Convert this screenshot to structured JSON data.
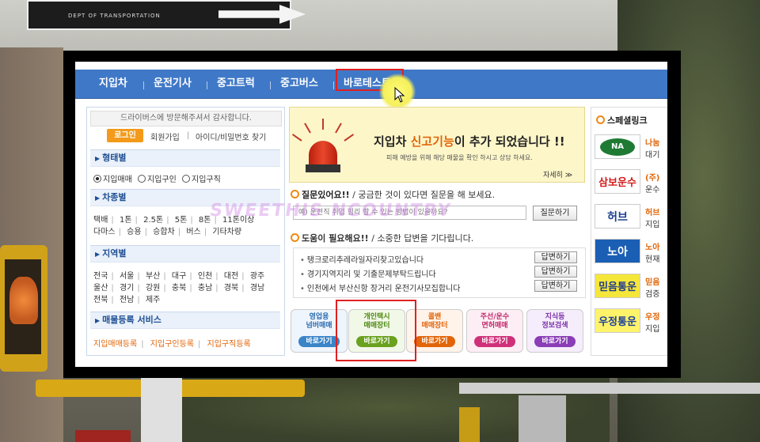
{
  "background": {
    "sign_text": "DEPT OF TRANSPORTATION"
  },
  "nav": {
    "items": [
      "지입차",
      "운전기사",
      "중고트럭",
      "중고버스",
      "바로테스트"
    ]
  },
  "left": {
    "welcome": "드라이버스에 방문해주셔서 감사합니다.",
    "login": "로그인",
    "join": "회원가입",
    "separator": "|",
    "find_id": "아이디/비밀번호 찾기",
    "type_title": "형태별",
    "type_options": [
      "지입매매",
      "지입구인",
      "지입구직"
    ],
    "type_selected": "지입매매",
    "vehicle_title": "차종별",
    "vehicle_row1": [
      "택배",
      "1톤",
      "2.5톤",
      "5톤",
      "8톤",
      "11톤이상"
    ],
    "vehicle_row2": [
      "다마스",
      "승용",
      "승합차",
      "버스",
      "기타차량"
    ],
    "region_title": "지역별",
    "region_row1": [
      "전국",
      "서울",
      "부산",
      "대구",
      "인천",
      "대전",
      "광주"
    ],
    "region_row2": [
      "울산",
      "경기",
      "강원",
      "충북",
      "충남",
      "경북",
      "경남"
    ],
    "region_row3": [
      "전북",
      "전남",
      "제주"
    ],
    "service_title": "매물등록 서비스",
    "service_links": [
      "지입매매등록",
      "지입구인등록",
      "지입구직등록"
    ]
  },
  "banner": {
    "title_pre": "지입차 ",
    "title_hl": "신고기능",
    "title_post": "이 추가 되었습니다 !!",
    "sub": "피해 예방을 위해 해당 매물을 확인 하시고 상담 하세요.",
    "more": "자세히 ≫"
  },
  "question": {
    "title": "질문있어요!!",
    "desc": " / 궁금한 것이 있다면 질문을 해 보세요.",
    "placeholder": "예) 운전직 취업 힘리 할 수 있는 방법이 있을까요?",
    "button": "질문하기",
    "watermark": "SWEETHIS NCOUNTRY"
  },
  "help": {
    "title": "도움이 필요해요!!",
    "desc": " / 소중한 답변을 기다립니다.",
    "items": [
      "탱크로리추레라일자리찾고있습니다",
      "경기지역지리 및 기출문제부탁드립니다",
      "인천에서 부산신항 장거리 운전기사모집합니다"
    ],
    "button": "답변하기"
  },
  "categories": [
    {
      "l1": "영업용",
      "l2": "넘버매매",
      "go": "바로가기",
      "color": "#3a84c8"
    },
    {
      "l1": "개인택시",
      "l2": "매매장터",
      "go": "바로가기",
      "color": "#6aa11f"
    },
    {
      "l1": "콜밴",
      "l2": "매매장터",
      "go": "바로가기",
      "color": "#e2650a"
    },
    {
      "l1": "주선/운수",
      "l2": "면허매매",
      "go": "바로가기",
      "color": "#d0307a"
    },
    {
      "l1": "지식등",
      "l2": "정보검색",
      "go": "바로가기",
      "color": "#8a3db6"
    }
  ],
  "special": {
    "title": "스페셜링크",
    "items": [
      {
        "logo": "NA",
        "name": "나눔",
        "desc": "대기"
      },
      {
        "logo": "삼보운수",
        "name": "(주)",
        "desc": "운수"
      },
      {
        "logo": "허브",
        "name": "허브",
        "desc": "지입"
      },
      {
        "logo": "노아",
        "name": "노아",
        "desc": "현재"
      },
      {
        "logo": "믿음통운",
        "name": "믿음",
        "desc": "검증"
      },
      {
        "logo": "우정통운",
        "name": "우정",
        "desc": "지입"
      }
    ]
  },
  "colors": {
    "nav_blue": "#3f78c7",
    "accent_orange": "#e2650a",
    "highlight_red": "#e02020"
  }
}
